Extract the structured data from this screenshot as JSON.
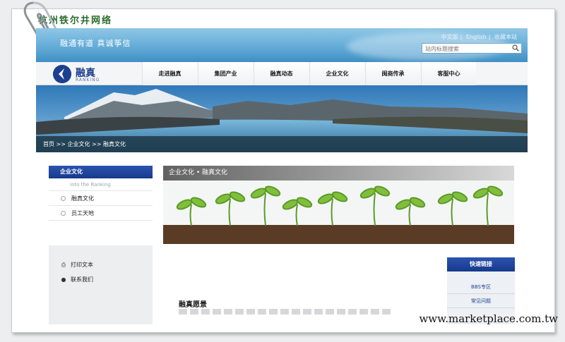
{
  "watermark_top": "杭州铁尔井网络",
  "header": {
    "slogan": "融通有道  真诚筝信",
    "links": [
      "中文版",
      "English",
      "收藏本站"
    ],
    "search_placeholder": "站内标题搜索"
  },
  "logo": {
    "name": "融真",
    "sub": "RANKING"
  },
  "nav": [
    "走进融真",
    "集团产业",
    "融真动态",
    "企业文化",
    "闽商传承",
    "客服中心"
  ],
  "breadcrumb": "首页 >> 企业文化 >> 融真文化",
  "sidebar": {
    "title": "企业文化",
    "subtitle": "Into the Ranking",
    "items": [
      "融真文化",
      "员工天地"
    ]
  },
  "tools": {
    "print": "打印文本",
    "contact": "联系我们"
  },
  "content": {
    "header": "企业文化  •  融真文化",
    "section_title": "融真愿景"
  },
  "quick_links": {
    "title": "快速链接",
    "items": [
      "BBS专区",
      "常见问题"
    ]
  },
  "watermark_bottom": "www.marketplace.com.tw",
  "colors": {
    "accent": "#1c3f8f",
    "sky": "#5fa9d6"
  }
}
